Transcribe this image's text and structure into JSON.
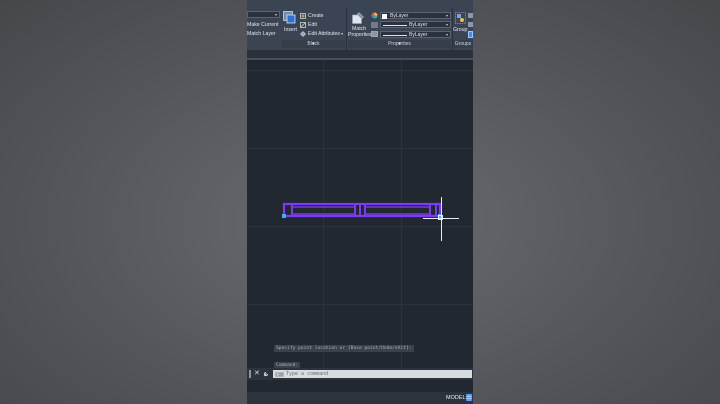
{
  "ribbon": {
    "make_current": "Make Current",
    "match_layer": "Match Layer",
    "insert": "Insert",
    "create": "Create",
    "edit": "Edit",
    "edit_attributes": "Edit Attributes",
    "match_properties_1": "Match",
    "match_properties_2": "Properties",
    "color_value": "ByLayer",
    "linetype_value": "ByLayer",
    "lineweight_value": "ByLayer",
    "group": "Group",
    "panels": {
      "block": "Block",
      "properties": "Properties",
      "groups": "Groups"
    }
  },
  "command_history": [
    "Specify point location or [Base point/Undo/eXit]:",
    "Command:",
    "Specify point location or [Base point/Undo/eXit]:"
  ],
  "command_input": {
    "placeholder": "Type a command"
  },
  "status_bar": {
    "model": "MODEL"
  },
  "colors": {
    "canvas": "#212830",
    "ribbon": "#3b4453",
    "selection": "#7b3bf2",
    "grip": "#4aa8ff"
  },
  "icons": [
    "insert-icon",
    "create-block-icon",
    "edit-block-icon",
    "edit-attributes-icon",
    "match-properties-icon",
    "color-wheel-icon",
    "linetype-icon",
    "lineweight-icon",
    "group-icon",
    "close-icon",
    "wrench-icon",
    "command-prompt-icon",
    "grid-display-icon"
  ]
}
